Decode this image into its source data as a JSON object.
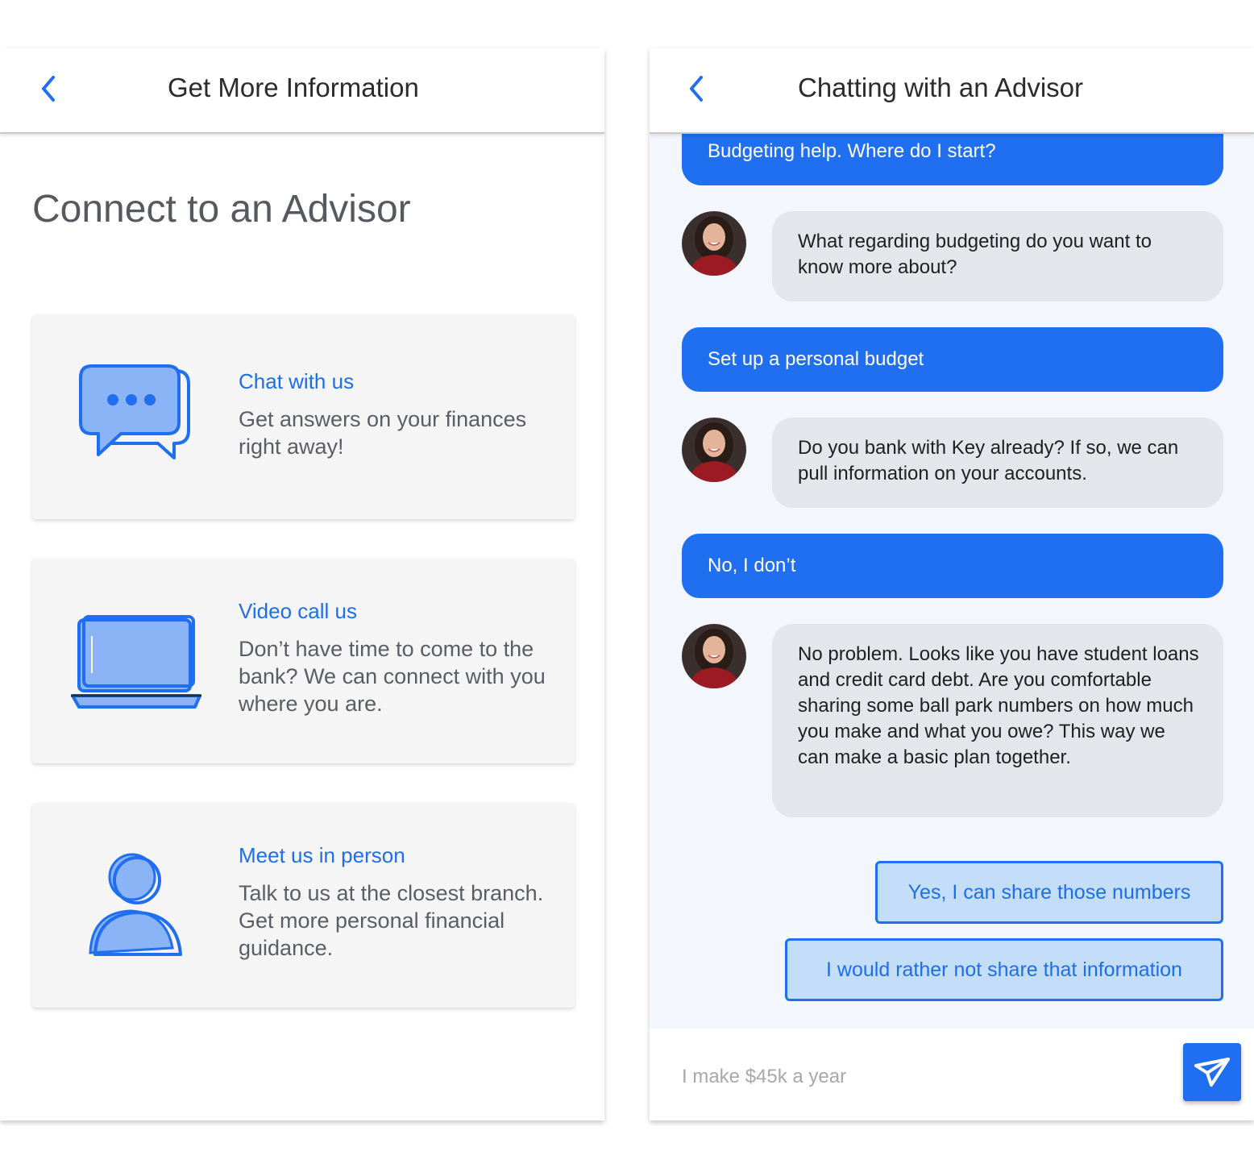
{
  "colors": {
    "accent": "#1f6ff0",
    "accent_light": "#c4defa",
    "card_bg": "#f5f5f6",
    "advisor_bubble": "#e3e6ea",
    "chat_bg": "#f3f6fc"
  },
  "left_screen": {
    "header": {
      "back_icon": "chevron-left-icon",
      "title": "Get More Information"
    },
    "heading": "Connect to an Advisor",
    "options": [
      {
        "icon": "chat-bubbles-icon",
        "title": "Chat with us",
        "description": "Get answers on your finances right away!"
      },
      {
        "icon": "laptop-icon",
        "title": "Video call us",
        "description": "Don’t have time to come to the bank? We can connect with you where you are."
      },
      {
        "icon": "person-icon",
        "title": "Meet us in person",
        "description": "Talk to us at the closest branch. Get more personal financial guidance."
      }
    ]
  },
  "right_screen": {
    "header": {
      "back_icon": "chevron-left-icon",
      "title": "Chatting with an Advisor"
    },
    "messages": [
      {
        "from": "user",
        "text": "Budgeting help. Where do I start?"
      },
      {
        "from": "advisor",
        "text": "What regarding budgeting do you want to know more about?"
      },
      {
        "from": "user",
        "text": "Set up a personal budget"
      },
      {
        "from": "advisor",
        "text": "Do you bank with Key already? If so, we can pull information on your accounts."
      },
      {
        "from": "user",
        "text": "No, I don’t"
      },
      {
        "from": "advisor",
        "text": "No problem. Looks like you have student loans and credit card debt. Are you comfortable sharing some ball park numbers on how much you make and what you owe? This way we can make a basic plan together."
      }
    ],
    "quick_replies": [
      "Yes, I can share those numbers",
      "I would rather not share that information"
    ],
    "composer": {
      "placeholder": "I make $45k a year",
      "send_icon": "send-icon"
    }
  }
}
